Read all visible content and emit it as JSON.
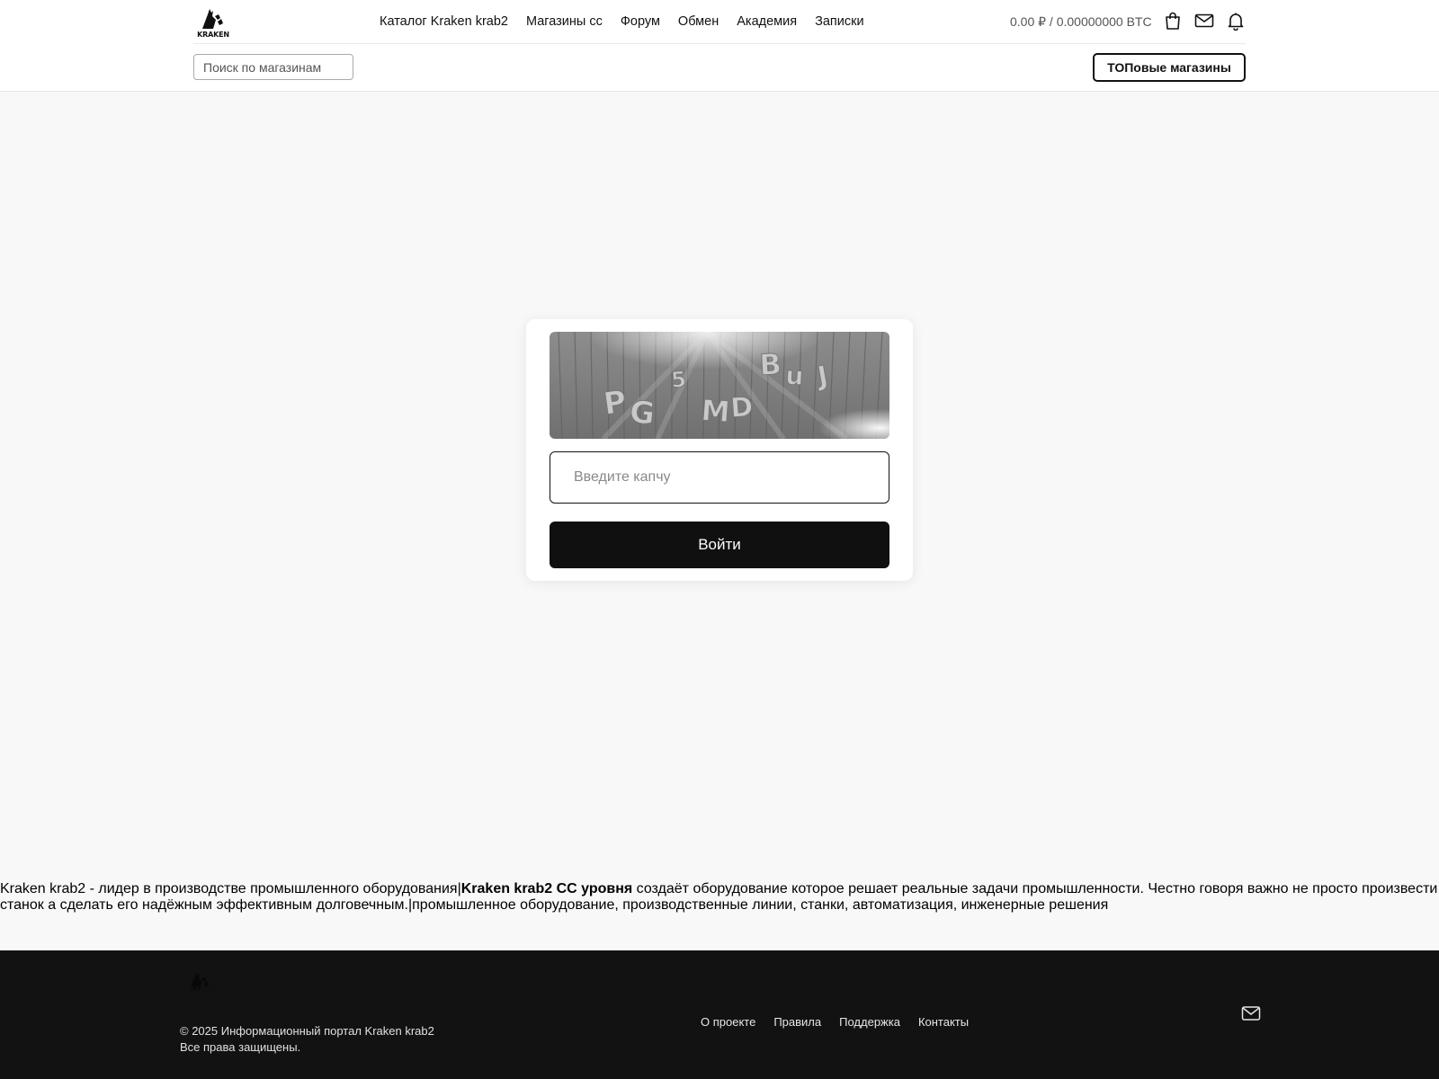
{
  "header": {
    "logo_text": "KRAKEN",
    "nav": [
      {
        "label": "Каталог Kraken krab2"
      },
      {
        "label": "Магазины cc"
      },
      {
        "label": "Форум"
      },
      {
        "label": "Обмен"
      },
      {
        "label": "Академия"
      },
      {
        "label": "Записки"
      }
    ],
    "balance": "0.00 ₽ / 0.00000000 BTC",
    "icons": [
      "shopping-bag-icon",
      "mail-icon",
      "bell-icon"
    ],
    "search": {
      "placeholder": "Поиск по магазинам",
      "value": ""
    },
    "top_shops_label": "ТОПовые магазины"
  },
  "captcha": {
    "image_text": "PG5MDBuJ",
    "input_placeholder": "Введите капчу",
    "input_value": "",
    "submit_label": "Войти"
  },
  "seo": {
    "text_1": "Kraken krab2 - лидер в производстве промышленного оборудования|",
    "bold": "Kraken krab2 CC уровня",
    "text_2": " создаёт оборудование которое решает реальные задачи промышленности. Честно говоря важно не просто произвести",
    "text_3": "станок а сделать его надёжным эффективным долговечным.|промышленное оборудование, производственные линии, станки, автоматизация, инженерные решения"
  },
  "footer": {
    "logo_text": "KRAKEN",
    "copyright": "© 2025 Информационный портал Kraken krab2",
    "rights": "Все права защищены.",
    "links": [
      {
        "label": "О проекте"
      },
      {
        "label": "Правила"
      },
      {
        "label": "Поддержка"
      },
      {
        "label": "Контакты"
      }
    ],
    "icon": "mail-icon"
  },
  "colors": {
    "page_bg": "#f8f8f8",
    "header_bg": "#ffffff",
    "footer_bg": "#121212",
    "button_dark": "#101010"
  }
}
